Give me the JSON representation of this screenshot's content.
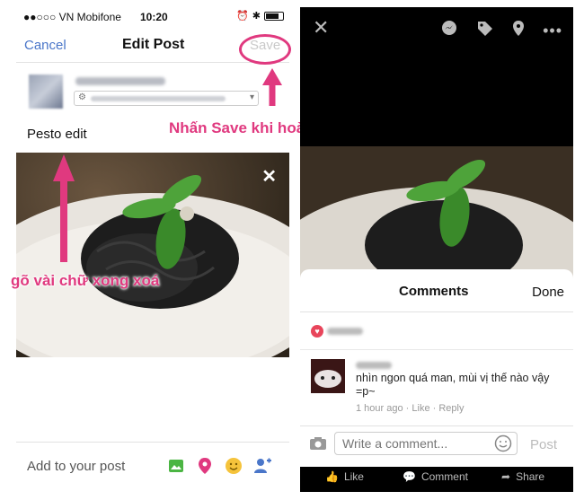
{
  "left": {
    "status_bar": {
      "carrier": "●●○○○ VN Mobifone",
      "time": "10:20"
    },
    "nav": {
      "cancel_label": "Cancel",
      "title": "Edit Post",
      "save_label": "Save"
    },
    "post_text": "Pesto edit",
    "add_to_post_label": "Add to your post",
    "annotations": {
      "save_hint": "Nhấn Save khi hoàn thành",
      "edit_hint": "gõ vài chữ xong xoá"
    },
    "colors": {
      "accent": "#4a76c9",
      "annotation": "#e0397f"
    }
  },
  "right": {
    "comments_title": "Comments",
    "done_label": "Done",
    "comment": {
      "text": "nhìn ngon quá man, mùi vị thế nào vậy =p~",
      "time": "1 hour ago",
      "like": "Like",
      "reply": "Reply"
    },
    "input": {
      "placeholder": "Write a comment...",
      "post_label": "Post"
    },
    "actions": {
      "like": "Like",
      "comment": "Comment",
      "share": "Share"
    }
  }
}
